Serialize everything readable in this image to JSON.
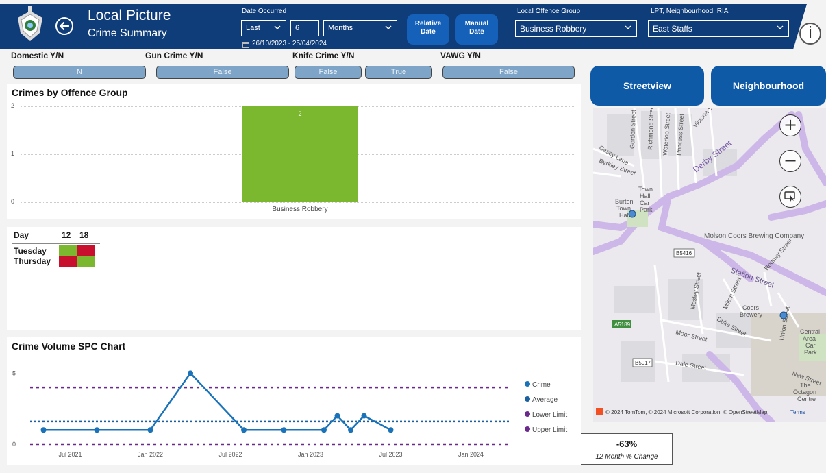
{
  "header": {
    "title": "Local Picture",
    "subtitle": "Crime Summary",
    "date_occurred_label": "Date Occurred",
    "period_mode": "Last",
    "period_count": "6",
    "period_unit": "Months",
    "relative_date_line1": "Relative",
    "relative_date_line2": "Date",
    "manual_date_line1": "Manual",
    "manual_date_line2": "Date",
    "date_range": "26/10/2023 - 25/04/2024",
    "offence_group_label": "Local Offence Group",
    "offence_group_value": "Business Robbery",
    "area_label": "LPT, Neighbourhood, RIA",
    "area_value": "East Staffs",
    "info_glyph": "i",
    "colors": {
      "header_bg": "#0f3d7a",
      "button": "#1560b8"
    }
  },
  "filters": {
    "domestic_label": "Domestic Y/N",
    "domestic_value": "N",
    "gun_label": "Gun Crime Y/N",
    "gun_value": "False",
    "knife_label": "Knife Crime Y/N",
    "knife_false": "False",
    "knife_true": "True",
    "vawg_label": "VAWG Y/N",
    "vawg_value": "False"
  },
  "offence_chart": {
    "title": "Crimes by Offence Group",
    "chart_data": {
      "type": "bar",
      "categories": [
        "Business Robbery"
      ],
      "values": [
        2
      ],
      "data_labels": [
        "2"
      ],
      "ylim": [
        0,
        2
      ],
      "yticks": [
        "0",
        "1",
        "2"
      ],
      "color": "#7cb82f"
    }
  },
  "matrix": {
    "day_header": "Day",
    "col1": "12",
    "col2": "18",
    "rows": [
      {
        "day": "Tuesday",
        "c12": "green",
        "c18": "red"
      },
      {
        "day": "Thursday",
        "c12": "red",
        "c18": "green"
      }
    ],
    "colors": {
      "green": "#7cb82f",
      "red": "#c8102e"
    }
  },
  "spc_chart": {
    "title": "Crime Volume SPC Chart",
    "chart_data": {
      "type": "line",
      "x": [
        "2021-05",
        "2021-09",
        "2022-01",
        "2022-04",
        "2022-08",
        "2022-11",
        "2023-02",
        "2023-03",
        "2023-04",
        "2023-05",
        "2023-07"
      ],
      "series": [
        {
          "name": "Crime",
          "values": [
            1,
            1,
            1,
            5,
            1,
            1,
            1,
            2,
            1,
            2,
            1
          ],
          "color": "#1a73b8"
        }
      ],
      "average": 1.6,
      "lower_limit": 0,
      "upper_limit": 4,
      "ylim": [
        0,
        5.5
      ],
      "yticks": [
        "0",
        "5"
      ],
      "xticks": [
        "Jul 2021",
        "Jan 2022",
        "Jul 2022",
        "Jan 2023",
        "Jul 2023",
        "Jan 2024"
      ],
      "xtick_dates": [
        "2021-07",
        "2022-01",
        "2022-07",
        "2023-01",
        "2023-07",
        "2024-01"
      ],
      "x_range": [
        "2021-04",
        "2024-04"
      ],
      "legend": [
        "Crime",
        "Average",
        "Lower Limit",
        "Upper Limit"
      ],
      "legend_colors": [
        "#1a73b8",
        "#1a5f9e",
        "#6a2a8c",
        "#6a2a8c"
      ],
      "legend_placement": "right"
    }
  },
  "map": {
    "streetview_label": "Streetview",
    "neighbourhood_label": "Neighbourhood",
    "zoom_in": "+",
    "zoom_out": "−",
    "streets": [
      "Derby Street",
      "Gordon Street",
      "Richmond Street",
      "Waterloo Street",
      "Princess Street",
      "Victoria Street",
      "Station Street",
      "Moor Street",
      "Duke Street",
      "Dale Street",
      "Milton Street",
      "Mosley Street",
      "Union Street",
      "New Street",
      "Casey Lane",
      "Byrkley Street",
      "Rodney Street"
    ],
    "places": [
      "Town Hall Car Park",
      "Burton Town Hall",
      "Molson Coors Brewing Company",
      "Coors Brewery",
      "Central Area Car Park",
      "The Octagon Centre"
    ],
    "road_codes": [
      "B5416",
      "A5189",
      "B5017"
    ],
    "attribution": "© 2024 TomTom, © 2024 Microsoft Corporation, © OpenStreetMap",
    "terms": "Terms"
  },
  "kpi": {
    "value": "-63%",
    "label": "12 Month % Change"
  }
}
